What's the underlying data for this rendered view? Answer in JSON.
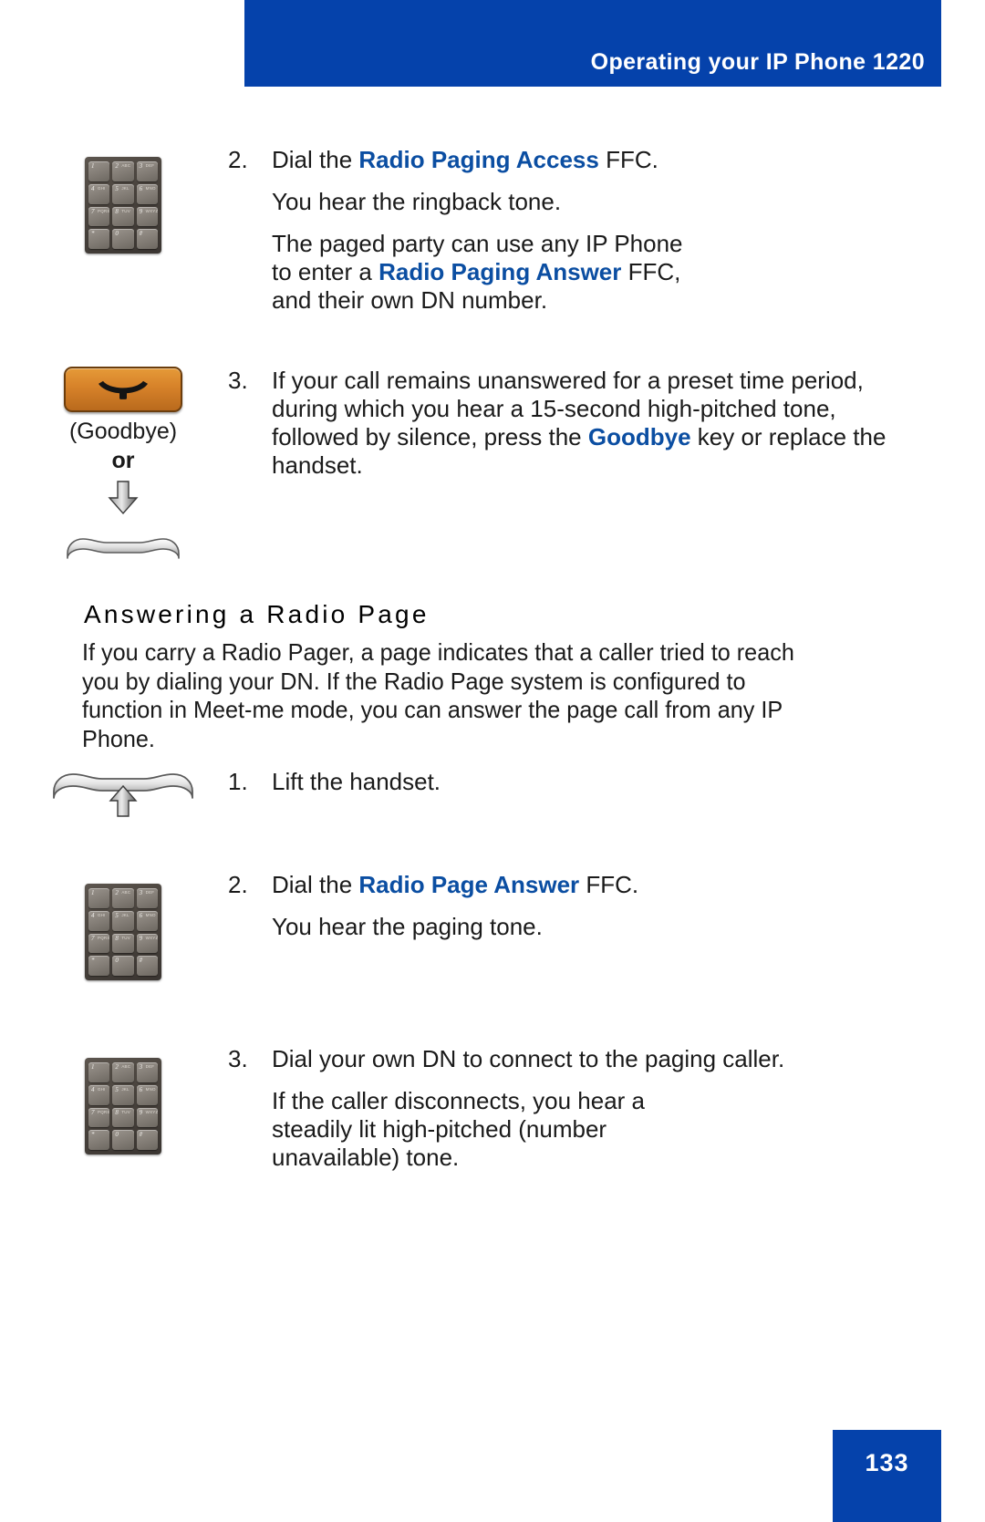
{
  "header": {
    "title": "Operating your IP Phone 1220",
    "bar_color": "#0542ab"
  },
  "footer": {
    "page_number": "133",
    "box_color": "#0542ab"
  },
  "accent_color": "#0b4ea2",
  "goodbye_key": {
    "caption": "(Goodbye)",
    "or_label": "or",
    "icon": "handset-down-icon",
    "color": "#d8832a"
  },
  "steps_top": [
    {
      "number": "2.",
      "icon": "keypad-icon",
      "lines": [
        {
          "type": "step",
          "segments": [
            {
              "text": "Dial the ",
              "bold": false
            },
            {
              "text": "Radio Paging Access",
              "bold": true
            },
            {
              "text": " FFC.",
              "bold": false
            }
          ]
        },
        {
          "type": "para",
          "segments": [
            {
              "text": "You hear the ringback tone.",
              "bold": false
            }
          ]
        },
        {
          "type": "para",
          "segments": [
            {
              "text": "The paged party can use any IP Phone to enter a ",
              "bold": false
            },
            {
              "text": "Radio Paging Answer",
              "bold": true
            },
            {
              "text": " FFC, and their own DN number.",
              "bold": false
            }
          ]
        }
      ]
    },
    {
      "number": "3.",
      "icon": "goodbye-key-icon",
      "lines": [
        {
          "type": "step",
          "segments": [
            {
              "text": "If your call remains unanswered for a preset time period, during which you hear a 15-second high-pitched tone, followed by silence, press the ",
              "bold": false
            },
            {
              "text": "Goodbye",
              "bold": true
            },
            {
              "text": " key or replace the handset.",
              "bold": false
            }
          ]
        }
      ]
    }
  ],
  "section": {
    "heading": "Answering a Radio Page",
    "paragraph": "If you carry a Radio Pager, a page indicates that a caller tried to reach you by dialing your DN. If the Radio Page system is configured to function in Meet-me mode, you can answer the page call from any IP Phone."
  },
  "steps_bottom": [
    {
      "number": "1.",
      "icon": "handset-lift-icon",
      "lines": [
        {
          "type": "step",
          "segments": [
            {
              "text": "Lift the handset.",
              "bold": false
            }
          ]
        }
      ]
    },
    {
      "number": "2.",
      "icon": "keypad-icon",
      "lines": [
        {
          "type": "step",
          "segments": [
            {
              "text": "Dial the ",
              "bold": false
            },
            {
              "text": "Radio Page Answer",
              "bold": true
            },
            {
              "text": " FFC.",
              "bold": false
            }
          ]
        },
        {
          "type": "para",
          "segments": [
            {
              "text": "You hear the paging tone.",
              "bold": false
            }
          ]
        }
      ]
    },
    {
      "number": "3.",
      "icon": "keypad-icon",
      "lines": [
        {
          "type": "step",
          "segments": [
            {
              "text": "Dial your own DN to connect to the paging caller.",
              "bold": false
            }
          ]
        },
        {
          "type": "para",
          "segments": [
            {
              "text": "If the caller disconnects, you hear a steadily lit high-pitched (number unavailable) tone.",
              "bold": false
            }
          ]
        }
      ]
    }
  ],
  "keypad": {
    "keys": [
      {
        "num": "1",
        "letters": ""
      },
      {
        "num": "2",
        "letters": "ABC"
      },
      {
        "num": "3",
        "letters": "DEF"
      },
      {
        "num": "4",
        "letters": "GHI"
      },
      {
        "num": "5",
        "letters": "JKL"
      },
      {
        "num": "6",
        "letters": "MNO"
      },
      {
        "num": "7",
        "letters": "PQRS"
      },
      {
        "num": "8",
        "letters": "TUV"
      },
      {
        "num": "9",
        "letters": "WXYZ"
      },
      {
        "num": "*",
        "letters": ""
      },
      {
        "num": "0",
        "letters": ""
      },
      {
        "num": "#",
        "letters": ""
      }
    ]
  }
}
